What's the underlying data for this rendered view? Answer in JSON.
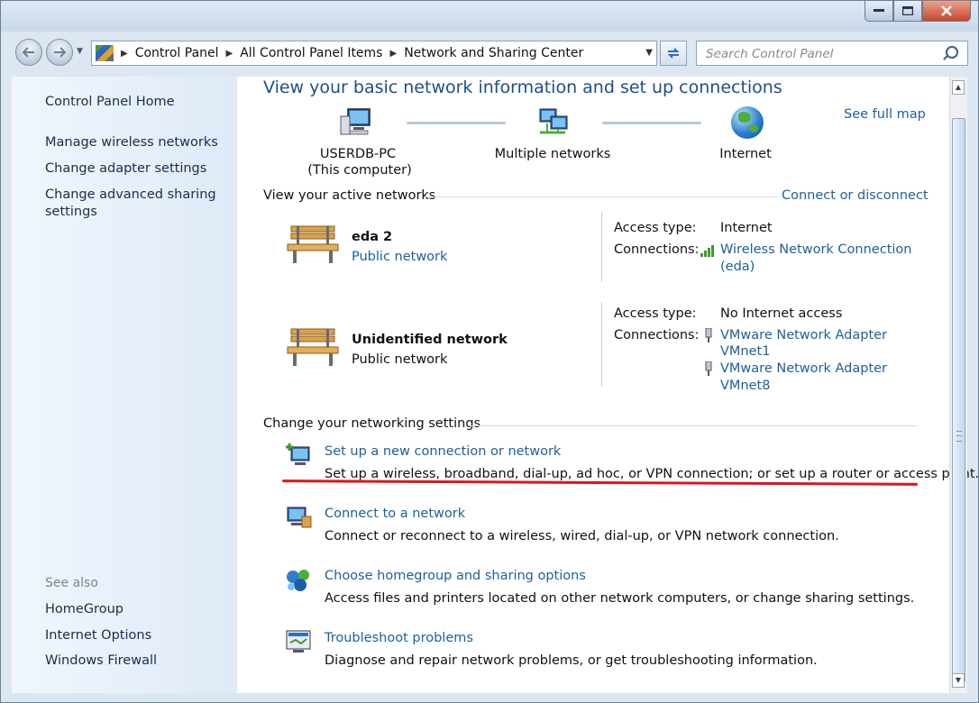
{
  "address": {
    "crumbs": [
      "Control Panel",
      "All Control Panel Items",
      "Network and Sharing Center"
    ]
  },
  "search": {
    "placeholder": "Search Control Panel"
  },
  "sidebar": {
    "home": "Control Panel Home",
    "links": [
      "Manage wireless networks",
      "Change adapter settings",
      "Change advanced sharing",
      "settings"
    ],
    "see_also_label": "See also",
    "see_also": [
      "HomeGroup",
      "Internet Options",
      "Windows Firewall"
    ]
  },
  "main": {
    "heading": "View your basic network information and set up connections",
    "see_full_map": "See full map",
    "map": {
      "computer_name": "USERDB-PC",
      "computer_sub": "(This computer)",
      "middle": "Multiple networks",
      "internet": "Internet"
    },
    "active_label": "View your active networks",
    "connect_disconnect": "Connect or disconnect",
    "networks": [
      {
        "name": "eda  2",
        "type": "Public network",
        "access_label": "Access type:",
        "access_value": "Internet",
        "connections_label": "Connections:",
        "connections": [
          "Wireless Network Connection",
          "(eda)"
        ]
      },
      {
        "name": "Unidentified network",
        "type": "Public network",
        "access_label": "Access type:",
        "access_value": "No Internet access",
        "connections_label": "Connections:",
        "connections": [
          "VMware Network Adapter",
          "VMnet1",
          "VMware Network Adapter",
          "VMnet8"
        ]
      }
    ],
    "settings_label": "Change your networking settings",
    "tasks": [
      {
        "title": "Set up a new connection or network",
        "desc": "Set up a wireless, broadband, dial-up, ad hoc, or VPN connection; or set up a router or access point."
      },
      {
        "title": "Connect to a network",
        "desc": "Connect or reconnect to a wireless, wired, dial-up, or VPN network connection."
      },
      {
        "title": "Choose homegroup and sharing options",
        "desc": "Access files and printers located on other network computers, or change sharing settings."
      },
      {
        "title": "Troubleshoot problems",
        "desc": "Diagnose and repair network problems, or get troubleshooting information."
      }
    ]
  },
  "colors": {
    "link": "#1e5f9e",
    "heading": "#1e4e8c",
    "highlight_underline": "#e0141a"
  }
}
